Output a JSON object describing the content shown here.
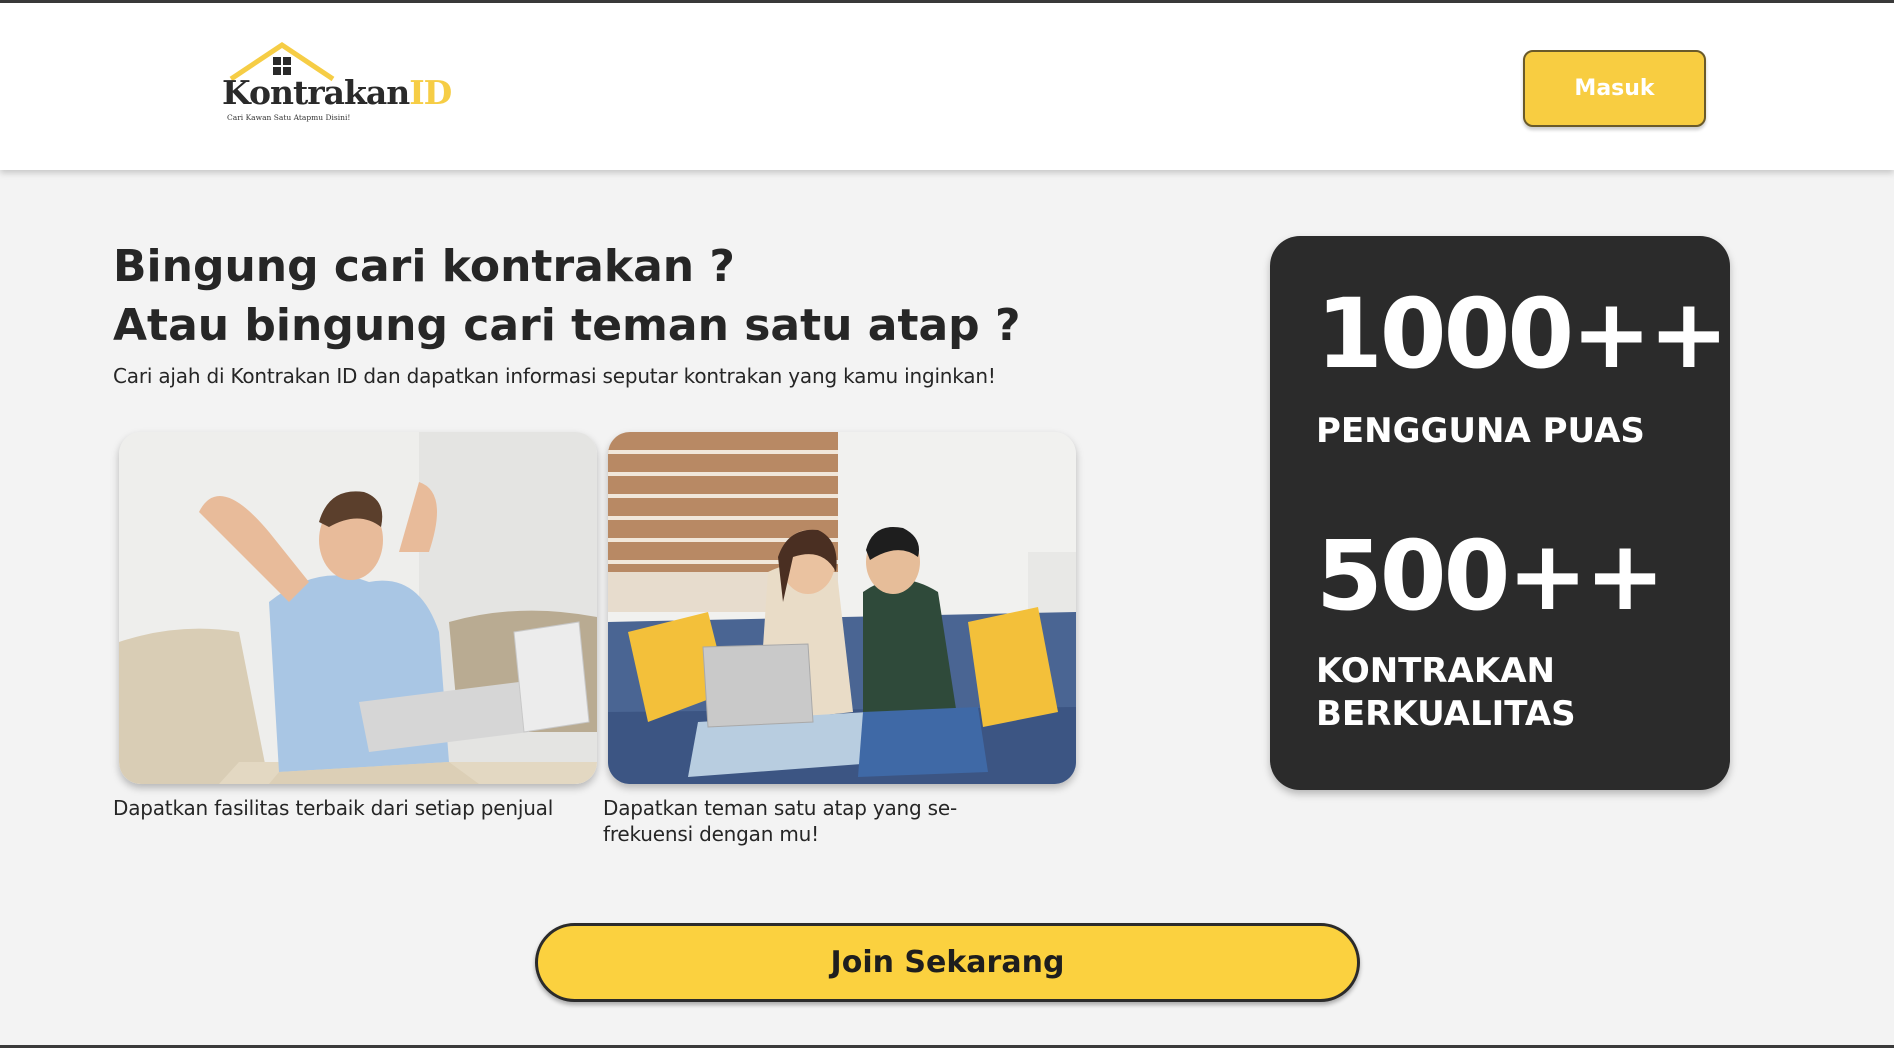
{
  "header": {
    "logo": {
      "name_main": "Kontrakan",
      "name_accent": "ID",
      "tagline": "Cari Kawan Satu Atapmu Disini!",
      "accent_color": "#f6cd45"
    },
    "login_label": "Masuk"
  },
  "hero": {
    "title_line1": "Bingung cari kontrakan ?",
    "title_line2": "Atau bingung cari teman satu atap ?",
    "subtitle": "Cari ajah di Kontrakan ID dan dapatkan informasi seputar kontrakan yang kamu inginkan!",
    "cards": [
      {
        "caption": "Dapatkan fasilitas terbaik dari setiap penjual",
        "image": "man-relaxing-with-laptop"
      },
      {
        "caption": "Dapatkan teman satu atap yang se-frekuensi dengan mu!",
        "image": "couple-on-sofa-with-laptop"
      }
    ]
  },
  "stats": [
    {
      "value": "1000++",
      "label": "PENGGUNA PUAS"
    },
    {
      "value": "500++",
      "label": "KONTRAKAN BERKUALITAS"
    }
  ],
  "cta": {
    "join_label": "Join Sekarang"
  },
  "colors": {
    "brand_yellow": "#f8cd41",
    "dark_panel": "#2b2b2b",
    "page_bg": "#f3f3f3"
  }
}
